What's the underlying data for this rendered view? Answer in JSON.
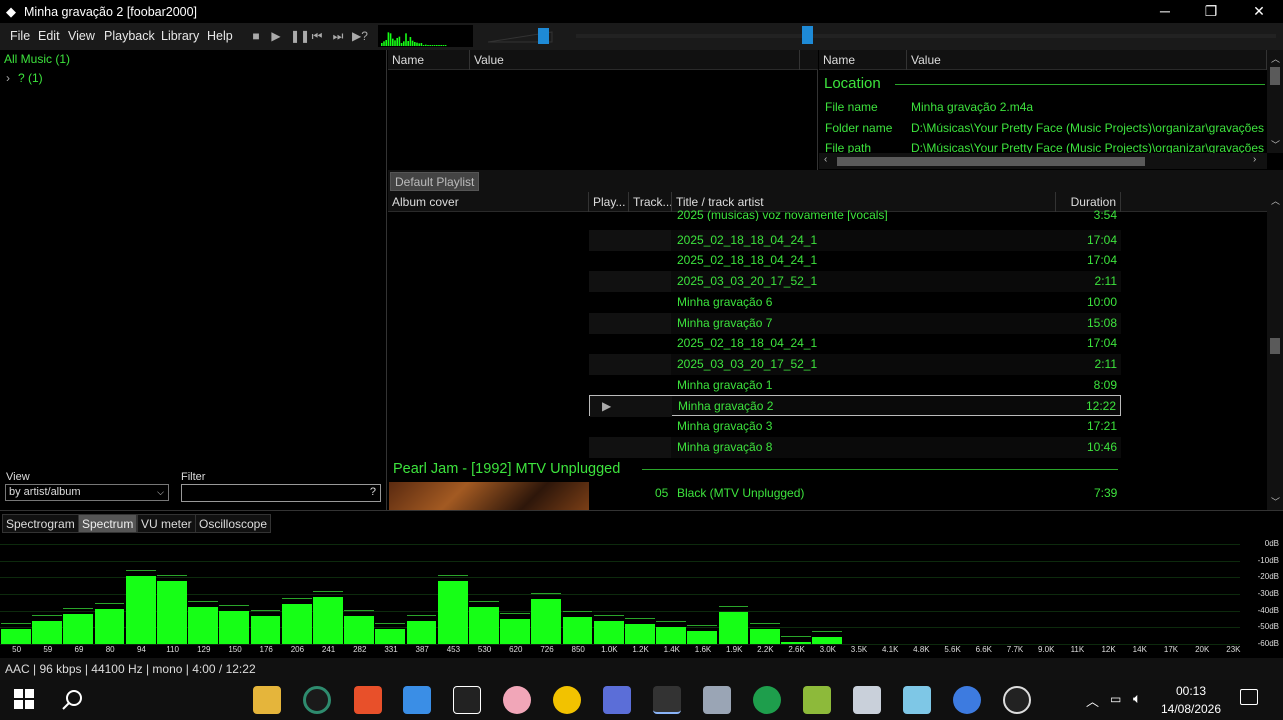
{
  "window": {
    "title": "Minha gravação 2  [foobar2000]"
  },
  "menu": {
    "items": [
      "File",
      "Edit",
      "View",
      "Playback",
      "Library",
      "Help"
    ]
  },
  "library": {
    "root": "All Music (1)",
    "child": "? (1)",
    "view_label": "View",
    "view_value": "by artist/album",
    "filter_label": "Filter",
    "filter_help": "?"
  },
  "props_left": {
    "col_name": "Name",
    "col_value": "Value"
  },
  "props_right": {
    "col_name": "Name",
    "col_value": "Value",
    "section": "Location",
    "rows": [
      {
        "name": "File name",
        "value": "Minha gravação 2.m4a"
      },
      {
        "name": "Folder name",
        "value": "D:\\Músicas\\Your Pretty Face (Music Projects)\\organizar\\gravações g"
      },
      {
        "name": "File path",
        "value": "D:\\Músicas\\Your Pretty Face (Music Projects)\\organizar\\gravações g"
      }
    ]
  },
  "playlist": {
    "tab": "Default Playlist",
    "cols": [
      "Album cover",
      "Play...",
      "Track...",
      "Title / track artist",
      "Duration"
    ],
    "rows": [
      {
        "title": "2025 (musicas) voz novamente [vocals]",
        "duration": "3:54"
      },
      {
        "title": "2025_02_18_18_04_24_1",
        "duration": "17:04"
      },
      {
        "title": "2025_02_18_18_04_24_1",
        "duration": "17:04"
      },
      {
        "title": "2025_03_03_20_17_52_1",
        "duration": "2:11"
      },
      {
        "title": "Minha gravação 6",
        "duration": "10:00"
      },
      {
        "title": "Minha gravação 7",
        "duration": "15:08"
      },
      {
        "title": "2025_02_18_18_04_24_1",
        "duration": "17:04"
      },
      {
        "title": "2025_03_03_20_17_52_1",
        "duration": "2:11"
      },
      {
        "title": "Minha gravação 1",
        "duration": "8:09"
      },
      {
        "title": "Minha gravação 2",
        "duration": "12:22"
      },
      {
        "title": "Minha gravação 3",
        "duration": "17:21"
      },
      {
        "title": "Minha gravação 8",
        "duration": "10:46"
      }
    ],
    "playing_index": 9,
    "group2": "Pearl Jam - [1992] MTV Unplugged",
    "group2_row": {
      "track": "05",
      "title": "Black (MTV Unplugged)",
      "duration": "7:39"
    }
  },
  "vis_tabs": [
    "Spectrogram",
    "Spectrum",
    "VU meter",
    "Oscilloscope"
  ],
  "spectrum": {
    "freq_labels": [
      "50",
      "59",
      "69",
      "80",
      "94",
      "110",
      "129",
      "150",
      "176",
      "206",
      "241",
      "282",
      "331",
      "387",
      "453",
      "530",
      "620",
      "726",
      "850",
      "1.0K",
      "1.2K",
      "1.4K",
      "1.6K",
      "1.9K",
      "2.2K",
      "2.6K",
      "3.0K",
      "3.5K",
      "4.1K",
      "4.8K",
      "5.6K",
      "6.6K",
      "7.7K",
      "9.0K",
      "11K",
      "12K",
      "14K",
      "17K",
      "20K",
      "23K"
    ],
    "db_labels": [
      "0dB",
      "-10dB",
      "-20dB",
      "-30dB",
      "-40dB",
      "-50dB",
      "-60dB"
    ],
    "levels": [
      -51,
      -46,
      -42,
      -39,
      -19,
      -22,
      -38,
      -40,
      -43,
      -36,
      -32,
      -43,
      -51,
      -46,
      -22,
      -38,
      -45,
      -33,
      -44,
      -46,
      -48,
      -50,
      -52,
      -41,
      -51,
      -59,
      -56,
      -60,
      -60,
      -60,
      -60,
      -60,
      -60,
      -60,
      -60,
      -60,
      -60,
      -60,
      -60,
      -60
    ],
    "bar_color": "#16ff16"
  },
  "status": "AAC | 96 kbps | 44100 Hz | mono | 4:00 / 12:22",
  "seek_fraction": 0.33,
  "volume_fraction": 0.88,
  "clock": {
    "time": "00:13",
    "date": "14/08/2026"
  }
}
